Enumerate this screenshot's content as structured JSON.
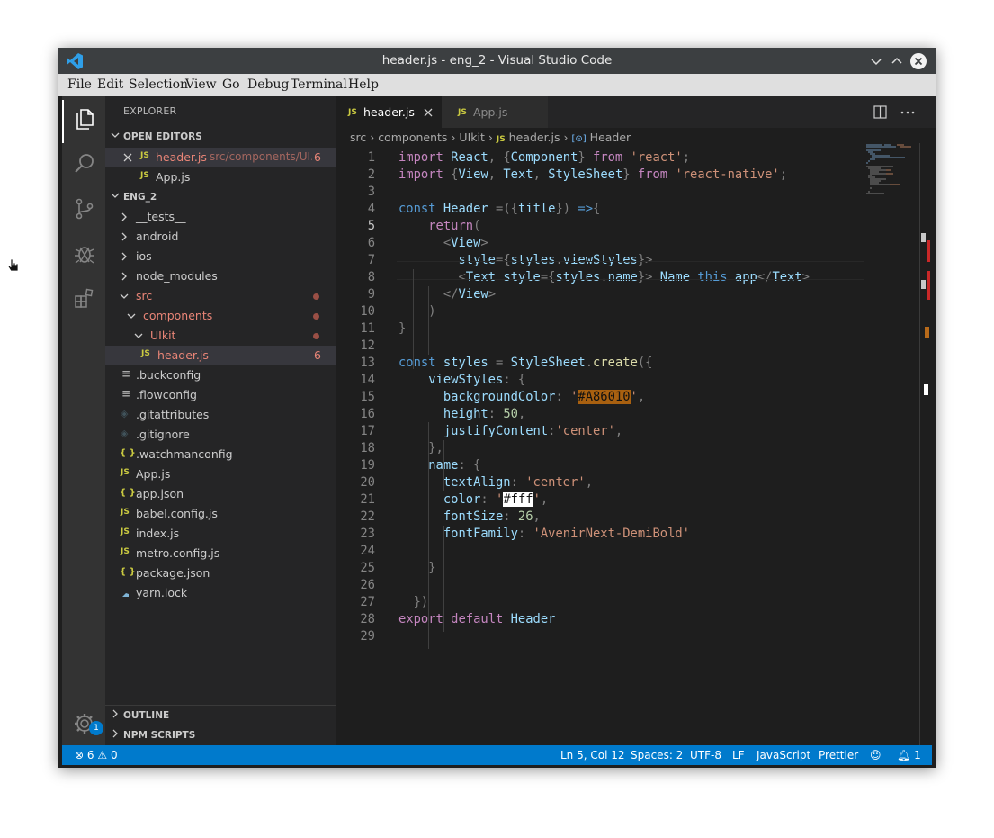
{
  "window": {
    "title": "header.js - eng_2 - Visual Studio Code"
  },
  "menu": [
    "File",
    "Edit",
    "Selection",
    "View",
    "Go",
    "Debug",
    "Terminal",
    "Help"
  ],
  "activity": {
    "settings_badge": "1"
  },
  "sidebar": {
    "header": "EXPLORER",
    "open_editors": {
      "title": "OPEN EDITORS",
      "items": [
        {
          "icon": "JS",
          "name": "header.js",
          "path": "src/components/UI...",
          "count": "6"
        },
        {
          "icon": "JS",
          "name": "App.js"
        }
      ]
    },
    "project": {
      "title": "ENG_2",
      "items": [
        {
          "name": "__tests__",
          "type": "folder"
        },
        {
          "name": "android",
          "type": "folder"
        },
        {
          "name": "ios",
          "type": "folder"
        },
        {
          "name": "node_modules",
          "type": "folder"
        },
        {
          "name": "src",
          "type": "folder-open"
        },
        {
          "name": "components",
          "type": "folder-open"
        },
        {
          "name": "UIkit",
          "type": "folder-open"
        },
        {
          "name": "header.js",
          "icon": "JS",
          "count": "6"
        },
        {
          "name": ".buckconfig",
          "icon": "≡"
        },
        {
          "name": ".flowconfig",
          "icon": "≡"
        },
        {
          "name": ".gitattributes",
          "icon": "◈"
        },
        {
          "name": ".gitignore",
          "icon": "◈"
        },
        {
          "name": ".watchmanconfig",
          "icon": "{ }"
        },
        {
          "name": "App.js",
          "icon": "JS"
        },
        {
          "name": "app.json",
          "icon": "{ }"
        },
        {
          "name": "babel.config.js",
          "icon": "JS"
        },
        {
          "name": "index.js",
          "icon": "JS"
        },
        {
          "name": "metro.config.js",
          "icon": "JS"
        },
        {
          "name": "package.json",
          "icon": "{ }"
        },
        {
          "name": "yarn.lock",
          "icon": "yarn"
        }
      ]
    },
    "outline": "OUTLINE",
    "npm_scripts": "NPM SCRIPTS"
  },
  "tabs": [
    {
      "icon": "JS",
      "label": "header.js",
      "active": true
    },
    {
      "icon": "JS",
      "label": "App.js",
      "active": false
    }
  ],
  "breadcrumb": [
    "src",
    "components",
    "UIkit",
    "header.js",
    "Header"
  ],
  "code_lines": [
    "import React, {Component} from 'react';",
    "import {View, Text, StyleSheet} from 'react-native';",
    "",
    "const Header =({title}) =>{",
    "    return(",
    "      <View>",
    "        style={styles.viewStyles}>",
    "        <Text style={styles.name}> Name this app</Text>",
    "      </View>",
    "    )",
    "}",
    "",
    "const styles = StyleSheet.create({",
    "    viewStyles: {",
    "      backgroundColor: '#A86010',",
    "      height: 50,",
    "      justifyContent:'center',",
    "    },",
    "    name: {",
    "      textAlign: 'center',",
    "      color: '#fff',",
    "      fontSize: 26,",
    "      fontFamily: 'AvenirNext-DemiBold'",
    "",
    "    }",
    "",
    "  })",
    "export default Header",
    ""
  ],
  "status": {
    "errors": "6",
    "warnings": "0",
    "position": "Ln 5, Col 12",
    "spaces": "Spaces: 2",
    "encoding": "UTF-8",
    "eol": "LF",
    "language": "JavaScript",
    "formatter": "Prettier",
    "notifications": "1"
  },
  "colors": {
    "accent": "#007acc",
    "swatch_bg": "#A86010",
    "swatch_fff": "#ffffff"
  }
}
